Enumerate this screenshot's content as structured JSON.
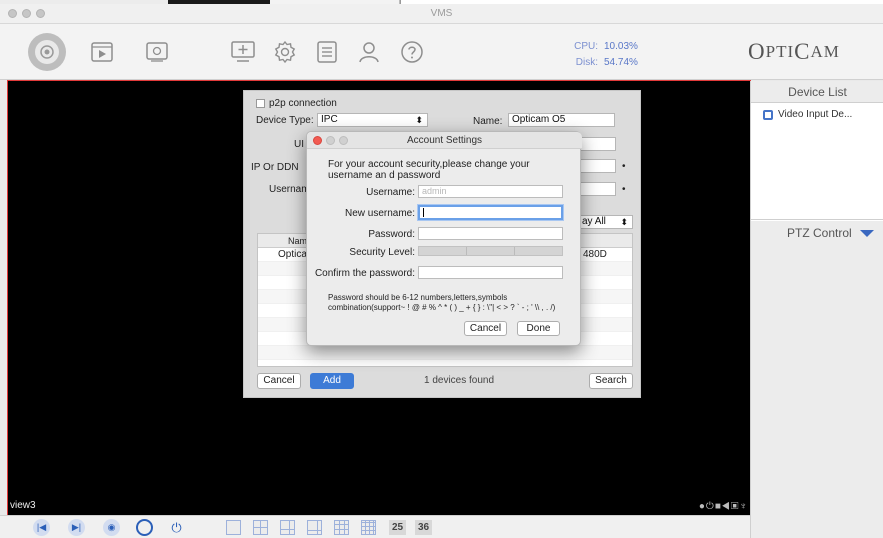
{
  "window": {
    "title": "VMS"
  },
  "toolbar": {
    "cpu_label": "CPU:",
    "cpu_value": "10.03%",
    "disk_label": "Disk:",
    "disk_value": "54.74%",
    "logo_big1": "O",
    "logo_mid": "PTI",
    "logo_big2": "C",
    "logo_end": "AM"
  },
  "video": {
    "view_label": "view3"
  },
  "sidebar": {
    "device_list_title": "Device List",
    "device_item": "Video Input De...",
    "ptz_title": "PTZ Control"
  },
  "add_device": {
    "p2p_label": "p2p connection",
    "device_type_label": "Device Type:",
    "device_type_value": "IPC",
    "name_label": "Name:",
    "name_value": "Opticam O5",
    "uid_label": "UI",
    "ip_label": "IP Or DDN",
    "username_label": "Usernam",
    "display_select": "ay All",
    "table_header": "Name",
    "table_rows": [
      {
        "name": "Opticar",
        "uid_tail": "480D"
      }
    ],
    "cancel_label": "Cancel",
    "add_label": "Add",
    "found_text": "1 devices found",
    "search_label": "Search"
  },
  "account_settings": {
    "title": "Account Settings",
    "message": "For your account security,please change your username an d password",
    "username_label": "Username:",
    "username_value": "admin",
    "new_username_label": "New username:",
    "new_username_value": "",
    "password_label": "Password:",
    "password_value": "",
    "security_label": "Security Level:",
    "confirm_label": "Confirm the password:",
    "confirm_value": "",
    "hint": "Password should be 6-12 numbers,letters,symbols combination(support~ ! @ # % ^ * ( ) _ + { } : \\\"| < > ? ` - ; ' \\\\ , . /)",
    "cancel_label": "Cancel",
    "done_label": "Done"
  },
  "bottombar": {
    "layout_25": "25",
    "layout_36": "36"
  },
  "colors": {
    "accent": "#3d7bd6",
    "video_border": "#e23a3a",
    "stat_text": "#5a78c8"
  }
}
